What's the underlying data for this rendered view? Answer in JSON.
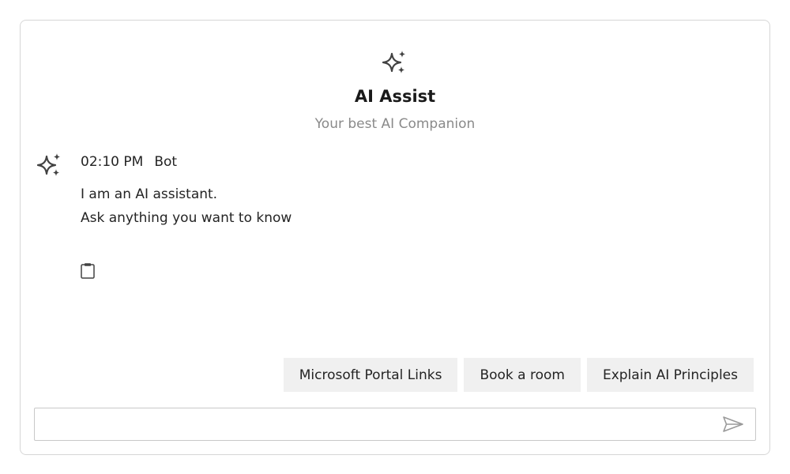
{
  "header": {
    "icon": "sparkle-icon",
    "title": "AI Assist",
    "subtitle": "Your best AI Companion"
  },
  "message": {
    "avatar_icon": "sparkle-icon",
    "time": "02:10 PM",
    "sender": "Bot",
    "lines": [
      "I am an AI assistant.",
      "Ask anything you want to know"
    ],
    "action_icon": "clipboard-icon"
  },
  "suggestions": [
    {
      "label": "Microsoft Portal Links"
    },
    {
      "label": "Book a room"
    },
    {
      "label": "Explain AI Principles"
    }
  ],
  "composer": {
    "value": "",
    "placeholder": "",
    "send_icon": "send-icon"
  },
  "colors": {
    "border": "#d6d6d6",
    "chip_bg": "#f0f0f0",
    "subtitle": "#8a8a8a",
    "icon": "#424242"
  }
}
